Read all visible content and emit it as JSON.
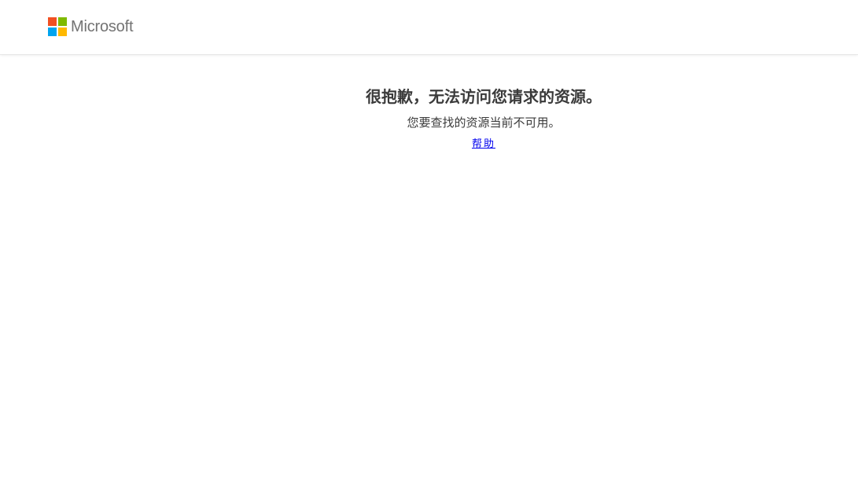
{
  "header": {
    "brand_name": "Microsoft",
    "logo_colors": [
      "#f25022",
      "#7fba00",
      "#00a4ef",
      "#ffb900"
    ]
  },
  "main": {
    "title": "很抱歉，无法访问您请求的资源。",
    "message": "您要查找的资源当前不可用。",
    "help_link": "帮助"
  }
}
